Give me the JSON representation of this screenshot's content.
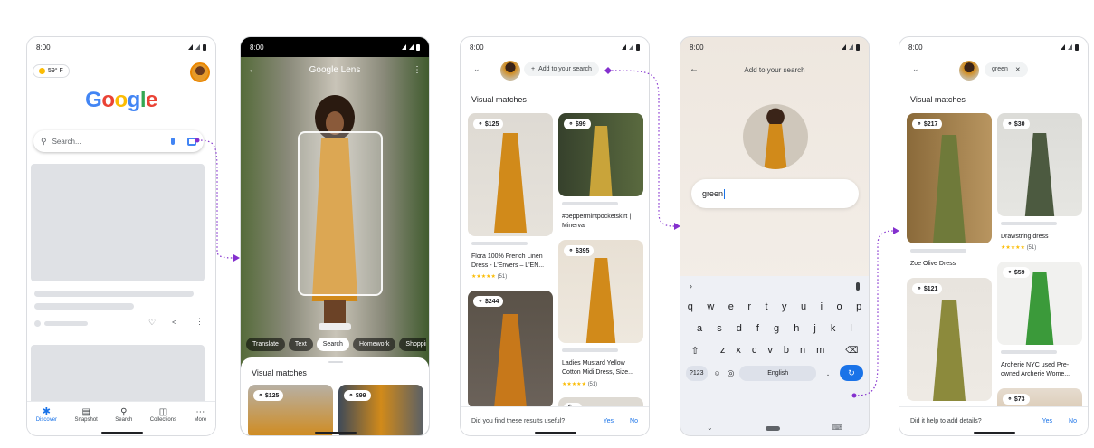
{
  "status_time": "8:00",
  "phone1": {
    "weather": "59° F",
    "logo": "Google",
    "search_placeholder": "Search...",
    "nav": [
      {
        "label": "Discover",
        "icon": "asterisk-icon"
      },
      {
        "label": "Snapshot",
        "icon": "snapshot-icon"
      },
      {
        "label": "Search",
        "icon": "search-icon"
      },
      {
        "label": "Collections",
        "icon": "collections-icon"
      },
      {
        "label": "More",
        "icon": "more-icon"
      }
    ]
  },
  "phone2": {
    "title": "Google Lens",
    "chips": [
      "Translate",
      "Text",
      "Search",
      "Homework",
      "Shopping"
    ],
    "active_chip": "Search",
    "sheet_title": "Visual matches",
    "prices": [
      "$125",
      "$99"
    ]
  },
  "phone3": {
    "add_label": "Add to your search",
    "section_title": "Visual matches",
    "items": [
      {
        "price": "$125",
        "caption": "Flora 100% French Linen Dress - L'Envers – L'EN...",
        "rating": "(51)"
      },
      {
        "price": "$99",
        "caption": "#peppermintpocketskirt | Minerva"
      },
      {
        "price": "$244"
      },
      {
        "price": "$395",
        "caption": "Ladies Mustard Yellow Cotton Midi Dress, Size...",
        "rating": "(51)"
      },
      {
        "price": "$..."
      }
    ],
    "feedback_question": "Did you find these results useful?",
    "yes": "Yes",
    "no": "No"
  },
  "phone4": {
    "title": "Add to your search",
    "input_value": "green",
    "keyboard_rows": [
      [
        "q",
        "w",
        "e",
        "r",
        "t",
        "y",
        "u",
        "i",
        "o",
        "p"
      ],
      [
        "a",
        "s",
        "d",
        "f",
        "g",
        "h",
        "j",
        "k",
        "l"
      ],
      [
        "z",
        "x",
        "c",
        "v",
        "b",
        "n",
        "m"
      ]
    ],
    "sym_key": "?123",
    "space_label": "English",
    "period_key": "."
  },
  "phone5": {
    "chip_label": "green",
    "section_title": "Visual matches",
    "items": [
      {
        "price": "$217",
        "caption": "Zoe Olive Dress"
      },
      {
        "price": "$30",
        "caption": "Drawstring dress",
        "rating": "(51)"
      },
      {
        "price": "$121"
      },
      {
        "price": "$59",
        "caption": "Archerie NYC used Pre-owned Archerie Wome..."
      },
      {
        "price": "$73"
      }
    ],
    "feedback_question": "Did it help to add details?",
    "yes": "Yes",
    "no": "No"
  },
  "colors": {
    "accent": "#1a73e8",
    "arrow": "#8430ce",
    "mustard": "#d18a1a",
    "olive": "#6f7a3a"
  }
}
